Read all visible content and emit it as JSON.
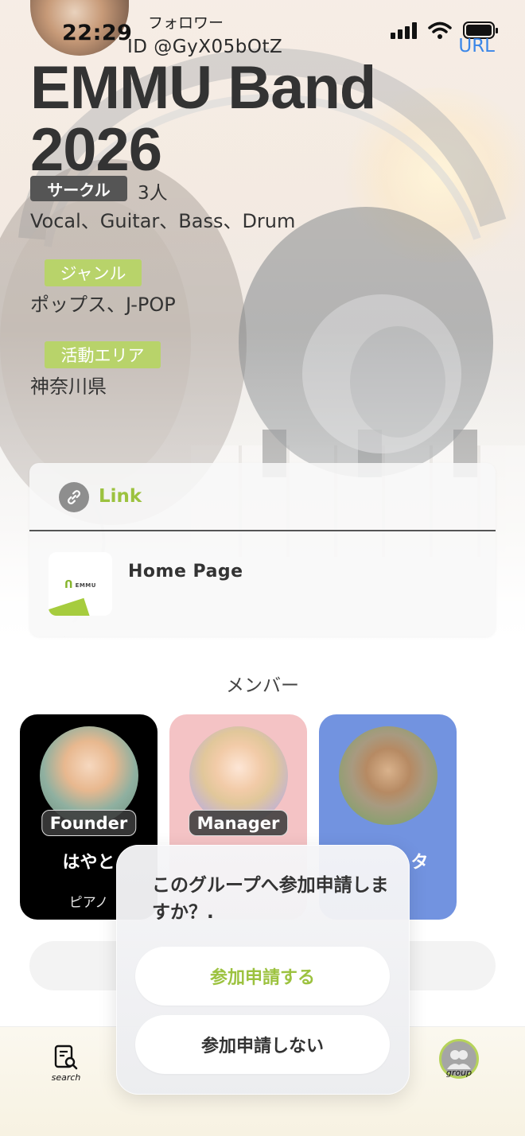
{
  "status_bar": {
    "time": "22:29"
  },
  "profile": {
    "followers_label": "フォロワー",
    "id_text": "ID @GyX05bOtZ",
    "url_label": "URL",
    "group_name": "EMMU Band 2026",
    "type_badge": "サークル",
    "member_count": "3人",
    "parts": "Vocal、Guitar、Bass、Drum",
    "genre_label": "ジャンル",
    "genre_value": "ポップス、J-POP",
    "area_label": "活動エリア",
    "area_value": "神奈川県"
  },
  "link_card": {
    "header": "Link",
    "homepage_label": "Home Page",
    "thumbnail_logo_text": "EMMU"
  },
  "members": {
    "heading": "メンバー",
    "cards": [
      {
        "role": "Founder",
        "name": "はやと",
        "part": "ピアノ",
        "color": "#000000"
      },
      {
        "role": "Manager",
        "name": "",
        "part": "",
        "color": "#f4c3c5"
      },
      {
        "role": "",
        "name": "タ",
        "part": "",
        "color": "#7293e0"
      }
    ]
  },
  "dialog": {
    "message": "このグループへ参加申請しますか？.",
    "confirm": "参加申請する",
    "cancel": "参加申請しない"
  },
  "bottom_nav": {
    "search_label": "search",
    "group_label": "group"
  },
  "colors": {
    "accent_green": "#9cc23f",
    "tag_green": "#b8d36a",
    "link_blue": "#3a86e8"
  }
}
